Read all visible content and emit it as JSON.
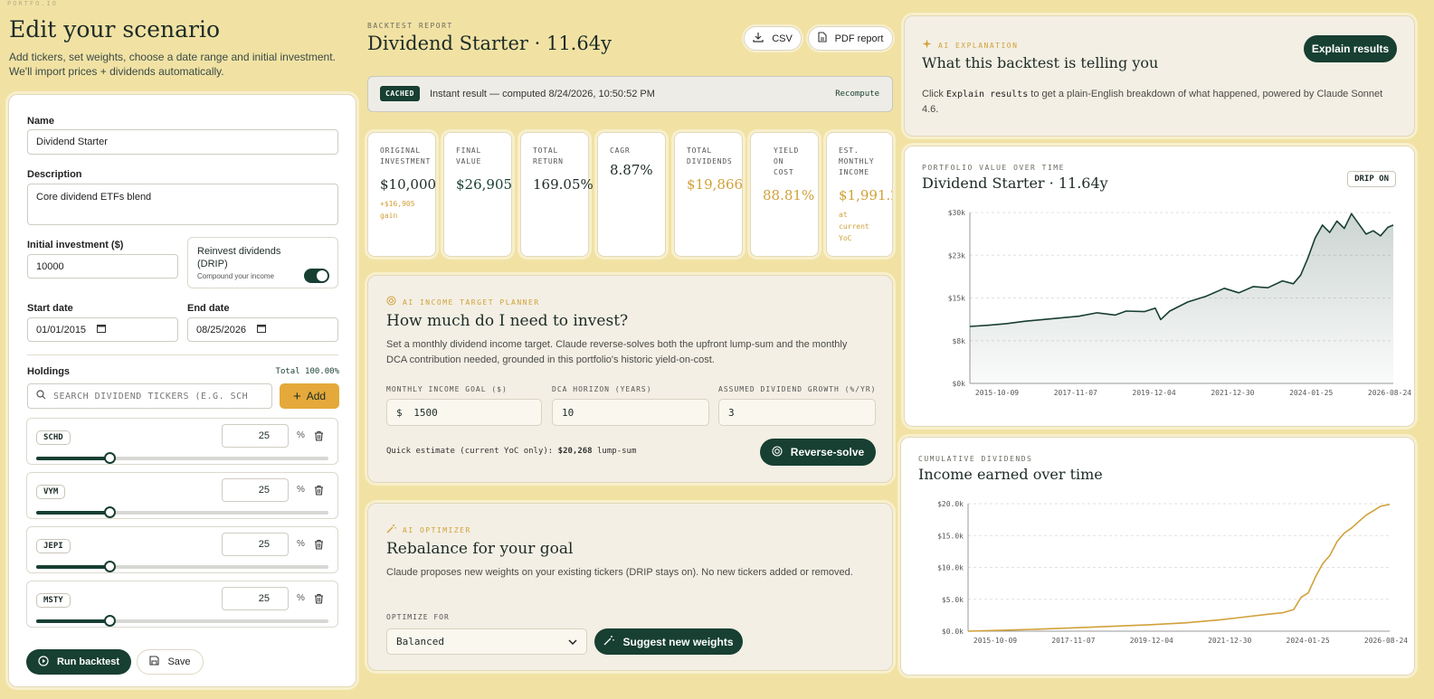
{
  "brand": "PORTFO.IO",
  "left": {
    "title": "Edit your scenario",
    "subtitle": "Add tickers, set weights, choose a date range and initial investment. We'll import prices + dividends automatically.",
    "name_label": "Name",
    "name_value": "Dividend Starter",
    "desc_label": "Description",
    "desc_value": "Core dividend ETFs blend",
    "initial_label": "Initial investment ($)",
    "initial_value": "10000",
    "drip_label": "Reinvest dividends (DRIP)",
    "drip_sub": "Compound your income",
    "start_label": "Start date",
    "start_value": "01/01/2015",
    "end_label": "End date",
    "end_value": "08/25/2026",
    "holdings_label": "Holdings",
    "holdings_total": "Total 100.00%",
    "search_placeholder": "SEARCH DIVIDEND TICKERS (E.G. SCH",
    "add_label": "Add",
    "holdings": [
      {
        "ticker": "SCHD",
        "weight": "25",
        "weight_fraction": 0.25
      },
      {
        "ticker": "VYM",
        "weight": "25",
        "weight_fraction": 0.25
      },
      {
        "ticker": "JEPI",
        "weight": "25",
        "weight_fraction": 0.25
      },
      {
        "ticker": "MSTY",
        "weight": "25",
        "weight_fraction": 0.25
      }
    ],
    "pct_sign": "%",
    "run_label": "Run backtest",
    "save_label": "Save"
  },
  "report": {
    "eyebrow": "BACKTEST REPORT",
    "title": "Dividend Starter · 11.64y",
    "csv_label": "CSV",
    "pdf_label": "PDF report",
    "cached_badge": "CACHED",
    "cached_text": "Instant result — computed 8/24/2026, 10:50:52 PM",
    "recompute_label": "Recompute",
    "metrics": [
      {
        "label": "ORIGINAL INVESTMENT",
        "value": "$10,000",
        "sub": "+$16,905 gain"
      },
      {
        "label": "FINAL VALUE",
        "value": "$26,905",
        "sub": ""
      },
      {
        "label": "TOTAL RETURN",
        "value": "169.05%",
        "sub": ""
      },
      {
        "label": "CAGR",
        "value": "8.87%",
        "sub": ""
      },
      {
        "label": "TOTAL DIVIDENDS",
        "value": "$19,866",
        "sub": ""
      },
      {
        "label": "YIELD ON COST",
        "value": "88.81%",
        "sub": ""
      },
      {
        "label": "EST. MONTHLY INCOME",
        "value": "$1,991.22",
        "sub": "at current YoC"
      }
    ]
  },
  "planner": {
    "eyebrow": "AI INCOME TARGET PLANNER",
    "title": "How much do I need to invest?",
    "desc": "Set a monthly dividend income target. Claude reverse-solves both the upfront lump-sum and the monthly DCA contribution needed, grounded in this portfolio's historic yield-on-cost.",
    "goal_label": "MONTHLY INCOME GOAL ($)",
    "goal_prefix": "$",
    "goal_value": "1500",
    "horizon_label": "DCA HORIZON (YEARS)",
    "horizon_value": "10",
    "growth_label": "ASSUMED DIVIDEND GROWTH (%/YR)",
    "growth_value": "3",
    "estimate_prefix": "Quick estimate (current YoC only):",
    "estimate_value": "$20,268",
    "estimate_suffix": "lump-sum",
    "solve_label": "Reverse-solve"
  },
  "optimizer": {
    "eyebrow": "AI OPTIMIZER",
    "title": "Rebalance for your goal",
    "desc": "Claude proposes new weights on your existing tickers (DRIP stays on). No new tickers added or removed.",
    "optimize_label": "OPTIMIZE FOR",
    "optimize_value": "Balanced",
    "suggest_label": "Suggest new weights"
  },
  "explain": {
    "eyebrow": "AI EXPLANATION",
    "title": "What this backtest is telling you",
    "button_label": "Explain results",
    "text_pre": "Click",
    "text_code": "Explain results",
    "text_post": "to get a plain-English breakdown of what happened, powered by Claude Sonnet 4.6."
  },
  "value_chart_meta": {
    "eyebrow": "PORTFOLIO VALUE OVER TIME",
    "title": "Dividend Starter · 11.64y",
    "badge": "DRIP ON"
  },
  "div_chart_meta": {
    "eyebrow": "CUMULATIVE DIVIDENDS",
    "title": "Income earned over time"
  },
  "chart_data": [
    {
      "type": "area",
      "title": "Dividend Starter · 11.64y",
      "yticks": [
        "$0k",
        "$8k",
        "$15k",
        "$23k",
        "$30k"
      ],
      "ylim": [
        0,
        30000
      ],
      "xticks": [
        "2015-10-09",
        "2017-11-07",
        "2019-12-04",
        "2021-12-30",
        "2024-01-25",
        "2026-08-24"
      ],
      "xlim": [
        2015.0,
        2026.65
      ],
      "color": "#173f32",
      "grid": true,
      "x": [
        2015.0,
        2015.5,
        2016.0,
        2016.5,
        2017.0,
        2017.5,
        2018.0,
        2018.5,
        2019.0,
        2019.3,
        2019.8,
        2020.1,
        2020.25,
        2020.5,
        2021.0,
        2021.5,
        2022.0,
        2022.4,
        2022.8,
        2023.2,
        2023.6,
        2023.9,
        2024.1,
        2024.3,
        2024.5,
        2024.7,
        2024.9,
        2025.1,
        2025.3,
        2025.5,
        2025.7,
        2025.9,
        2026.1,
        2026.3,
        2026.5,
        2026.65
      ],
      "y": [
        10000,
        10200,
        10500,
        10900,
        11200,
        11500,
        11800,
        12400,
        12000,
        12700,
        12600,
        13200,
        11200,
        12700,
        14300,
        15300,
        16700,
        15900,
        17000,
        16800,
        18000,
        17500,
        19000,
        22000,
        25500,
        27800,
        26500,
        28500,
        27200,
        29800,
        28000,
        26200,
        26800,
        25900,
        27400,
        27800
      ]
    },
    {
      "type": "line",
      "title": "Income earned over time",
      "yticks": [
        "$0.0k",
        "$5.0k",
        "$10.0k",
        "$15.0k",
        "$20.0k"
      ],
      "ylim": [
        0,
        20000
      ],
      "xticks": [
        "2015-10-09",
        "2017-11-07",
        "2019-12-04",
        "2021-12-30",
        "2024-01-25",
        "2026-08-24"
      ],
      "xlim": [
        2015.0,
        2026.65
      ],
      "color": "#d1a13a",
      "grid": true,
      "x": [
        2015.0,
        2016.0,
        2017.0,
        2018.0,
        2019.0,
        2020.0,
        2021.0,
        2022.0,
        2022.6,
        2023.2,
        2023.7,
        2024.0,
        2024.2,
        2024.4,
        2024.6,
        2024.8,
        2025.0,
        2025.2,
        2025.4,
        2025.6,
        2025.8,
        2026.0,
        2026.2,
        2026.4,
        2026.65
      ],
      "y": [
        0,
        150,
        330,
        540,
        760,
        1000,
        1300,
        1800,
        2200,
        2600,
        2900,
        3400,
        5300,
        6000,
        8500,
        10600,
        11900,
        14100,
        15400,
        16200,
        17200,
        18200,
        18900,
        19600,
        19866
      ]
    }
  ]
}
